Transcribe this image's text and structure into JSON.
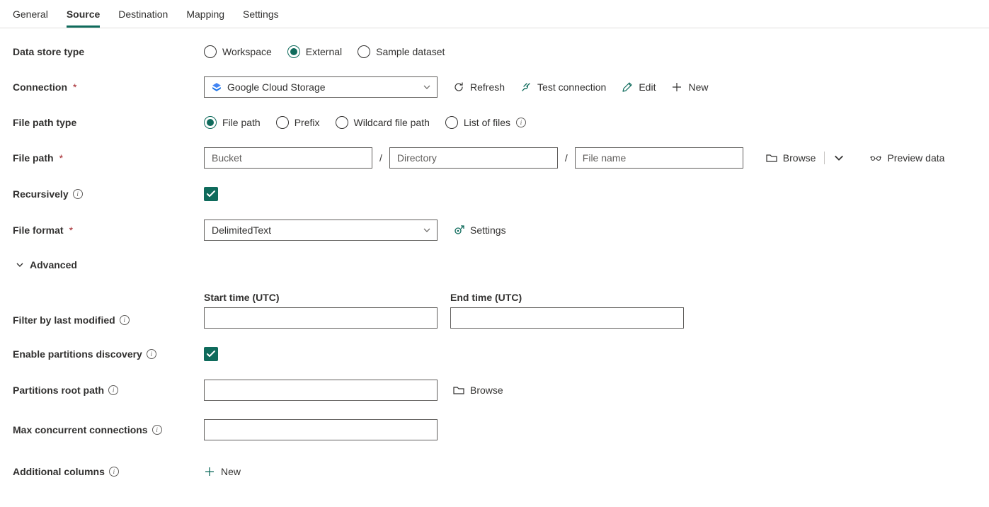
{
  "tabs": {
    "general": "General",
    "source": "Source",
    "destination": "Destination",
    "mapping": "Mapping",
    "settings": "Settings"
  },
  "labels": {
    "data_store_type": "Data store type",
    "connection": "Connection",
    "file_path_type": "File path type",
    "file_path": "File path",
    "recursively": "Recursively",
    "file_format": "File format",
    "advanced": "Advanced",
    "filter_by_last_modified": "Filter by last modified",
    "enable_partitions_discovery": "Enable partitions discovery",
    "partitions_root_path": "Partitions root path",
    "max_concurrent_connections": "Max concurrent connections",
    "additional_columns": "Additional columns",
    "start_time": "Start time (UTC)",
    "end_time": "End time (UTC)"
  },
  "data_store_type": {
    "workspace": "Workspace",
    "external": "External",
    "sample": "Sample dataset"
  },
  "connection": {
    "value": "Google Cloud Storage",
    "refresh": "Refresh",
    "test": "Test connection",
    "edit": "Edit",
    "new": "New"
  },
  "file_path_type": {
    "file_path": "File path",
    "prefix": "Prefix",
    "wildcard": "Wildcard file path",
    "list": "List of files"
  },
  "file_path": {
    "bucket_ph": "Bucket",
    "directory_ph": "Directory",
    "filename_ph": "File name",
    "browse": "Browse",
    "preview": "Preview data"
  },
  "file_format": {
    "value": "DelimitedText",
    "settings": "Settings"
  },
  "partitions": {
    "browse": "Browse"
  },
  "additional_columns": {
    "new": "New"
  }
}
